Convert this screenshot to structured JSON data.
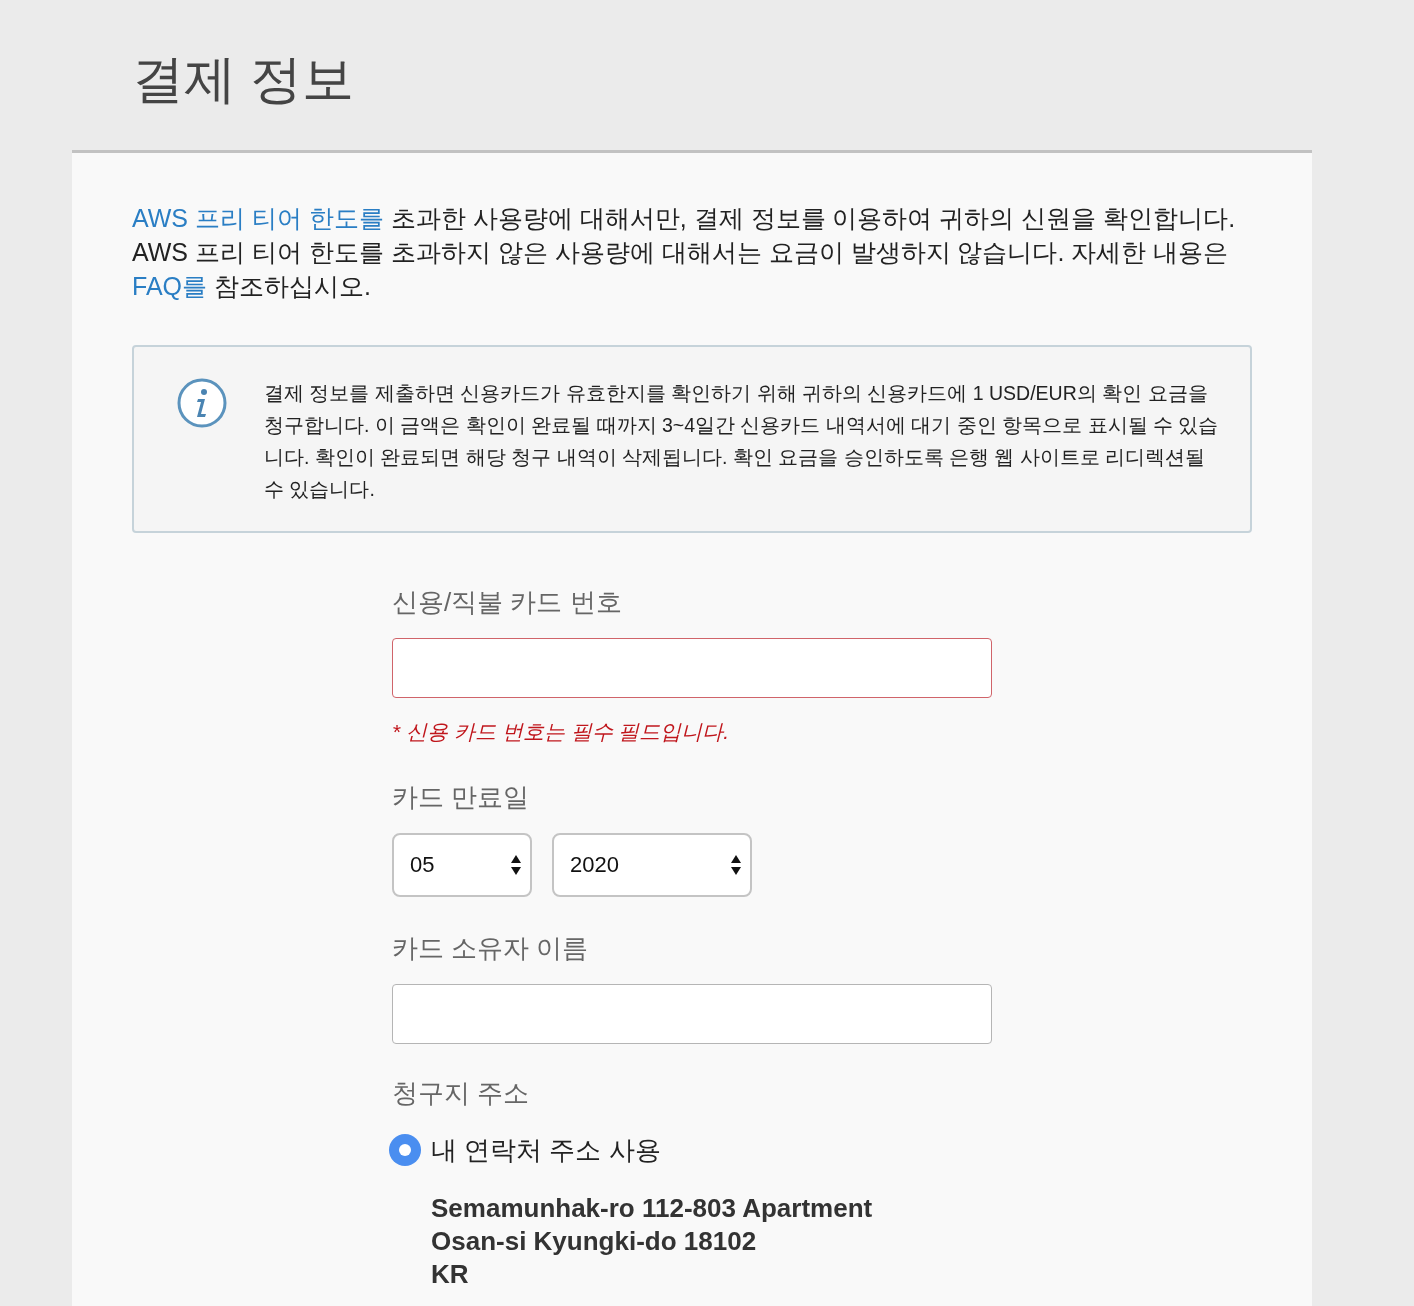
{
  "page_title": "결제 정보",
  "intro": [
    {
      "text": "AWS 프리 티어 한도를",
      "link": true
    },
    {
      "text": " 초과한 사용량에 대해서만, 결제 정보를 이용하여 귀하의 신원을 확인합니다. AWS 프리 티어 한도를 초과하지 않은 사용량에 대해서는 요금이 발생하지 않습니다. 자세한 내용은 ",
      "link": false
    },
    {
      "text": "FAQ를",
      "link": true
    },
    {
      "text": " 참조하십시오.",
      "link": false
    }
  ],
  "info_box": {
    "text": "결제 정보를 제출하면 신용카드가 유효한지를 확인하기 위해 귀하의 신용카드에 1 USD/EUR의 확인 요금을 청구합니다. 이 금액은 확인이 완료될 때까지 3~4일간 신용카드 내역서에 대기 중인 항목으로 표시될 수 있습니다. 확인이 완료되면 해당 청구 내역이 삭제됩니다. 확인 요금을 승인하도록 은행 웹 사이트로 리디렉션될 수 있습니다."
  },
  "card_number": {
    "label": "신용/직불 카드 번호",
    "error": true,
    "error_message": "* 신용 카드 번호는 필수 필드입니다."
  },
  "expiry": {
    "label": "카드 만료일",
    "month": "05",
    "year": "2020"
  },
  "cardholder": {
    "label": "카드 소유자 이름",
    "error": false
  },
  "billing": {
    "label": "청구지 주소",
    "options": [
      {
        "label": "내 연락처 주소 사용",
        "selected": true,
        "address": [
          "Semamunhak-ro 112-803 Apartment",
          "Osan-si Kyungki-do 18102",
          "KR"
        ]
      }
    ]
  }
}
